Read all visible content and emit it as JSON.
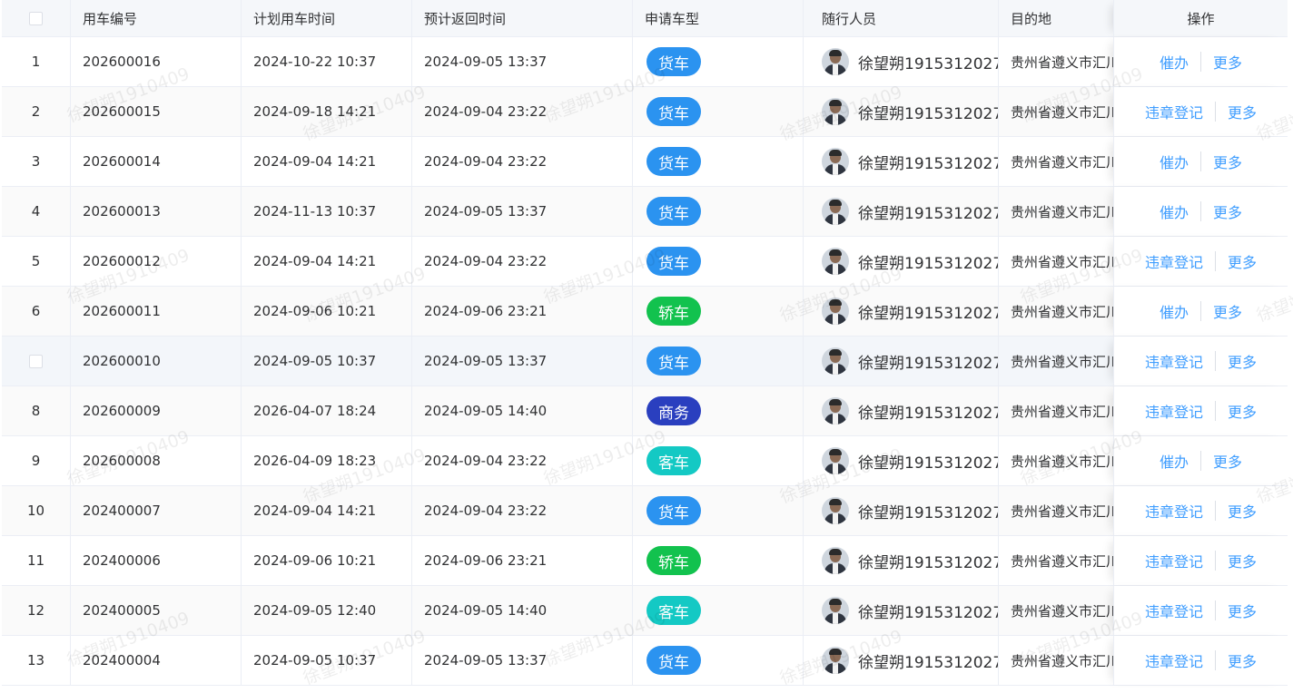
{
  "header": {
    "columns": [
      "用车编号",
      "计划用车时间",
      "预计返回时间",
      "申请车型",
      "随行人员",
      "目的地",
      "操作"
    ]
  },
  "colors": {
    "货车": "#2b93f0",
    "轿车": "#12c24e",
    "商务": "#2a3fbf",
    "客车": "#14c9c4"
  },
  "watermark": "徐望朔1910409",
  "rows": [
    {
      "idx": "1",
      "no": "202600016",
      "plan": "2024-10-22 10:37",
      "ret": "2024-09-05 13:37",
      "type": "货车",
      "person": "徐望朔1915312027",
      "dest": "贵州省遵义市汇川区",
      "ops": [
        "催办",
        "更多"
      ]
    },
    {
      "idx": "2",
      "no": "202600015",
      "plan": "2024-09-18 14:21",
      "ret": "2024-09-04 23:22",
      "type": "货车",
      "person": "徐望朔1915312027",
      "dest": "贵州省遵义市汇川区",
      "ops": [
        "违章登记",
        "更多"
      ]
    },
    {
      "idx": "3",
      "no": "202600014",
      "plan": "2024-09-04 14:21",
      "ret": "2024-09-04 23:22",
      "type": "货车",
      "person": "徐望朔1915312027",
      "dest": "贵州省遵义市汇川区",
      "ops": [
        "催办",
        "更多"
      ]
    },
    {
      "idx": "4",
      "no": "202600013",
      "plan": "2024-11-13 10:37",
      "ret": "2024-09-05 13:37",
      "type": "货车",
      "person": "徐望朔1915312027",
      "dest": "贵州省遵义市汇川区",
      "ops": [
        "催办",
        "更多"
      ]
    },
    {
      "idx": "5",
      "no": "202600012",
      "plan": "2024-09-04 14:21",
      "ret": "2024-09-04 23:22",
      "type": "货车",
      "person": "徐望朔1915312027",
      "dest": "贵州省遵义市汇川区",
      "ops": [
        "违章登记",
        "更多"
      ]
    },
    {
      "idx": "6",
      "no": "202600011",
      "plan": "2024-09-06 10:21",
      "ret": "2024-09-06 23:21",
      "type": "轿车",
      "person": "徐望朔1915312027",
      "dest": "贵州省遵义市汇川区",
      "ops": [
        "催办",
        "更多"
      ]
    },
    {
      "idx": "",
      "no": "202600010",
      "plan": "2024-09-05 10:37",
      "ret": "2024-09-05 13:37",
      "type": "货车",
      "person": "徐望朔1915312027",
      "dest": "贵州省遵义市汇川区",
      "ops": [
        "违章登记",
        "更多"
      ]
    },
    {
      "idx": "8",
      "no": "202600009",
      "plan": "2026-04-07 18:24",
      "ret": "2024-09-05 14:40",
      "type": "商务",
      "person": "徐望朔1915312027",
      "dest": "贵州省遵义市汇川区",
      "ops": [
        "违章登记",
        "更多"
      ]
    },
    {
      "idx": "9",
      "no": "202600008",
      "plan": "2026-04-09 18:23",
      "ret": "2024-09-04 23:22",
      "type": "客车",
      "person": "徐望朔1915312027",
      "dest": "贵州省遵义市汇川区",
      "ops": [
        "催办",
        "更多"
      ]
    },
    {
      "idx": "10",
      "no": "202400007",
      "plan": "2024-09-04 14:21",
      "ret": "2024-09-04 23:22",
      "type": "货车",
      "person": "徐望朔1915312027",
      "dest": "贵州省遵义市汇川区",
      "ops": [
        "违章登记",
        "更多"
      ]
    },
    {
      "idx": "11",
      "no": "202400006",
      "plan": "2024-09-06 10:21",
      "ret": "2024-09-06 23:21",
      "type": "轿车",
      "person": "徐望朔1915312027",
      "dest": "贵州省遵义市汇川区",
      "ops": [
        "违章登记",
        "更多"
      ]
    },
    {
      "idx": "12",
      "no": "202400005",
      "plan": "2024-09-05 12:40",
      "ret": "2024-09-05 14:40",
      "type": "客车",
      "person": "徐望朔1915312027",
      "dest": "贵州省遵义市汇川区",
      "ops": [
        "违章登记",
        "更多"
      ]
    },
    {
      "idx": "13",
      "no": "202400004",
      "plan": "2024-09-05 10:37",
      "ret": "2024-09-05 13:37",
      "type": "货车",
      "person": "徐望朔1915312027",
      "dest": "贵州省遵义市汇川区",
      "ops": [
        "违章登记",
        "更多"
      ]
    }
  ]
}
